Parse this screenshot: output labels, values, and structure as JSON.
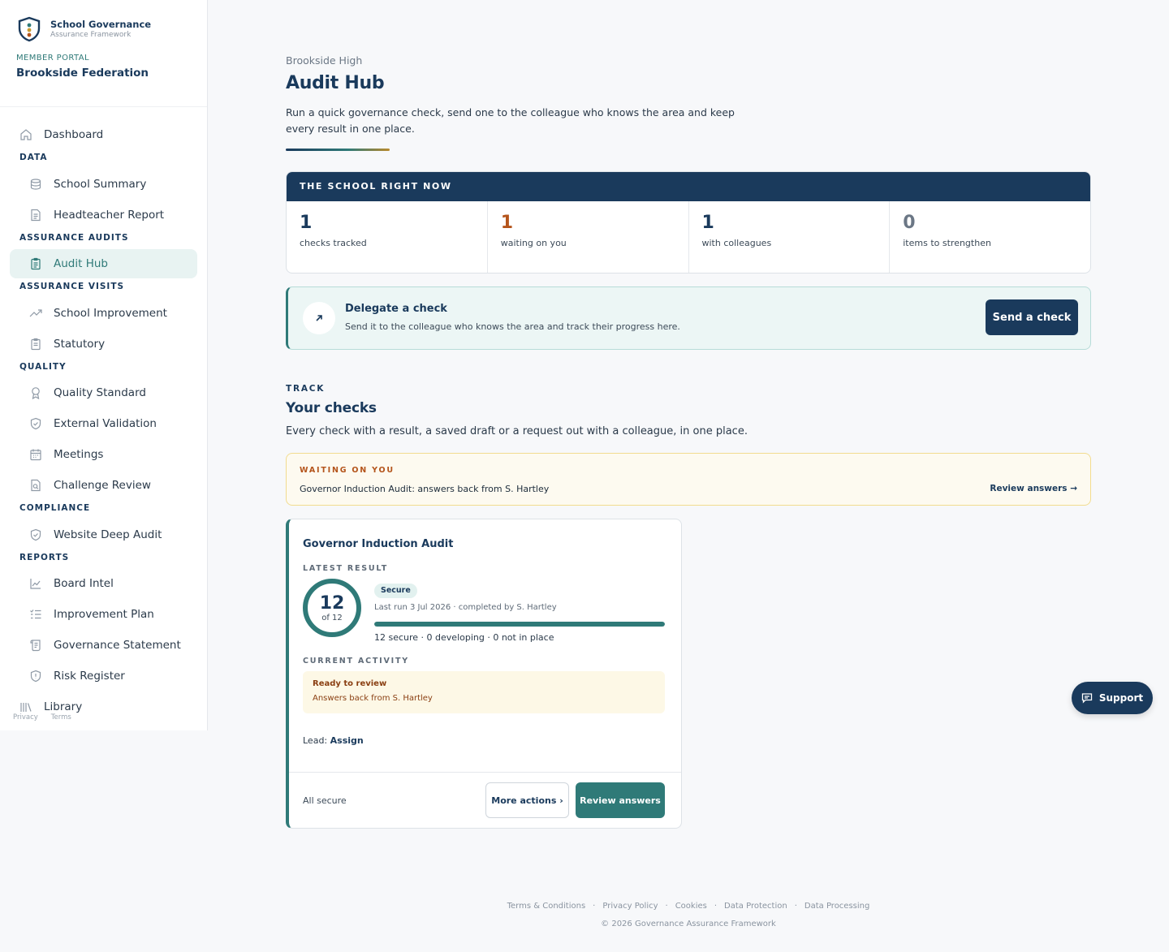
{
  "brand": {
    "title": "School Governance",
    "subtitle": "Assurance Framework"
  },
  "portal": {
    "label": "MEMBER PORTAL",
    "name": "Brookside Federation"
  },
  "sidebar": {
    "dashboard": "Dashboard",
    "sections": {
      "data": "DATA",
      "audits": "ASSURANCE AUDITS",
      "visits": "ASSURANCE VISITS",
      "quality": "QUALITY",
      "compliance": "COMPLIANCE",
      "reports": "REPORTS"
    },
    "items": {
      "school_summary": "School Summary",
      "headteacher_report": "Headteacher Report",
      "audit_hub": "Audit Hub",
      "school_improvement": "School Improvement",
      "statutory": "Statutory",
      "quality_standard": "Quality Standard",
      "external_validation": "External Validation",
      "meetings": "Meetings",
      "challenge_review": "Challenge Review",
      "website_deep_audit": "Website Deep Audit",
      "board_intel": "Board Intel",
      "improvement_plan": "Improvement Plan",
      "governance_statement": "Governance Statement",
      "risk_register": "Risk Register",
      "library": "Library"
    },
    "footer": {
      "privacy": "Privacy",
      "terms": "Terms"
    }
  },
  "page": {
    "breadcrumb": "Brookside High",
    "title": "Audit Hub",
    "description": "Run a quick governance check, send one to the colleague who knows the area and keep every result in one place."
  },
  "stats": {
    "heading": "THE SCHOOL RIGHT NOW",
    "items": [
      {
        "value": "1",
        "label": "checks tracked"
      },
      {
        "value": "1",
        "label": "waiting on you"
      },
      {
        "value": "1",
        "label": "with colleagues"
      },
      {
        "value": "0",
        "label": "items to strengthen"
      }
    ]
  },
  "delegate": {
    "title": "Delegate a check",
    "subtitle": "Send it to the colleague who knows the area and track their progress here.",
    "button": "Send a check"
  },
  "track": {
    "label": "TRACK",
    "title": "Your checks",
    "description": "Every check with a result, a saved draft or a request out with a colleague, in one place."
  },
  "waiting": {
    "label": "WAITING ON YOU",
    "text": "Governor Induction Audit: answers back from S. Hartley",
    "link": "Review answers →"
  },
  "check": {
    "title": "Governor Induction Audit",
    "latest_label": "LATEST RESULT",
    "score": "12",
    "score_of": "of 12",
    "badge": "Secure",
    "last_run": "Last run 3 Jul 2026 · completed by S. Hartley",
    "progress_fraction": 1.0,
    "breakdown": "12 secure · 0 developing · 0 not in place",
    "activity_label": "CURRENT ACTIVITY",
    "activity_title": "Ready to review",
    "activity_sub": "Answers back from S. Hartley",
    "lead_label": "Lead:",
    "lead_value": "Assign",
    "status": "All secure",
    "more_actions": "More actions ›",
    "review": "Review answers"
  },
  "support": "Support",
  "footer": {
    "links": [
      "Terms & Conditions",
      "Privacy Policy",
      "Cookies",
      "Data Protection",
      "Data Processing"
    ],
    "copyright": "© 2026 Governance Assurance Framework"
  },
  "colors": {
    "navy": "#1a3a5c",
    "teal": "#2f7a78",
    "orange": "#b4541b",
    "amber_bg": "#fdfaf0"
  }
}
